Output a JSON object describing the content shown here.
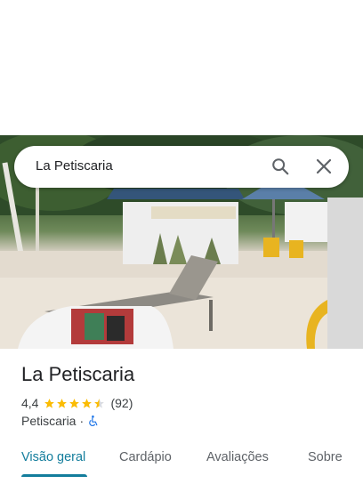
{
  "search": {
    "query": "La Petiscaria"
  },
  "place": {
    "name": "La Petiscaria",
    "rating": "4,4",
    "rating_value": 4.4,
    "review_count": "(92)",
    "category": "Petiscaria",
    "separator": "·"
  },
  "tabs": [
    {
      "label": "Visão geral",
      "active": true
    },
    {
      "label": "Cardápio",
      "active": false
    },
    {
      "label": "Avaliações",
      "active": false
    },
    {
      "label": "Sobre",
      "active": false
    }
  ],
  "colors": {
    "accent": "#137d9c",
    "star": "#fbbc04",
    "accessibility": "#1a73e8"
  },
  "icons": {
    "search": "search-icon",
    "close": "close-icon",
    "star": "star-icon",
    "accessibility": "wheelchair-icon"
  }
}
